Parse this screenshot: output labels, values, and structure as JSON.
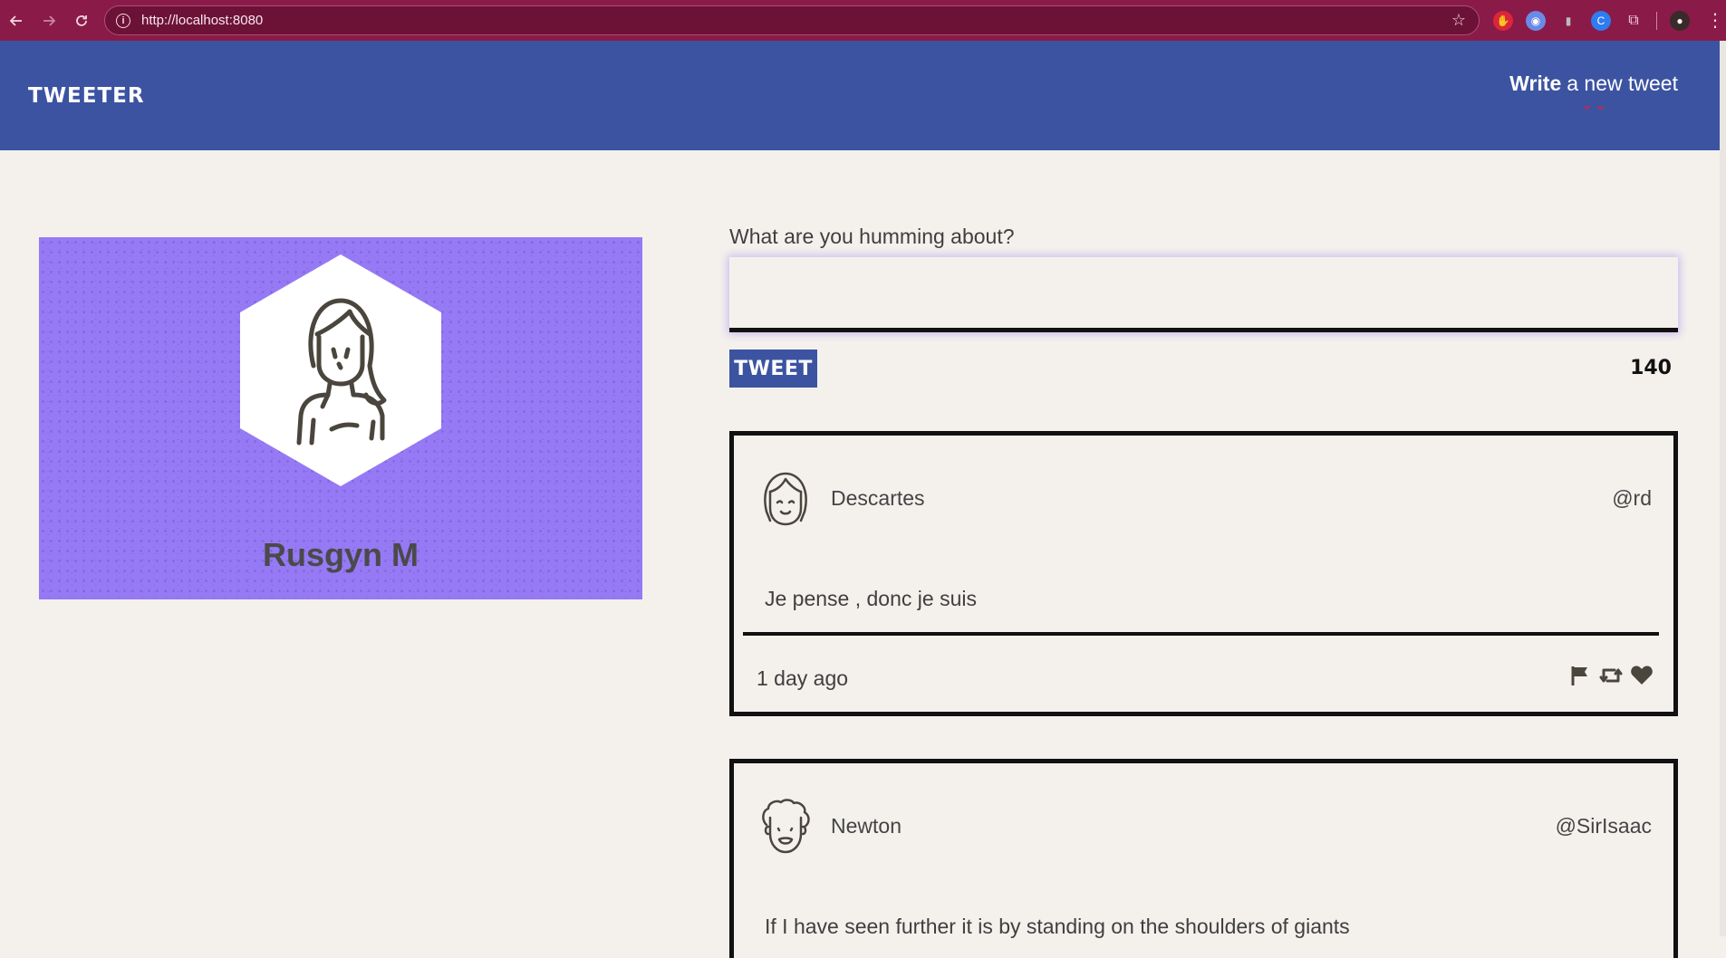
{
  "browser": {
    "url": "http://localhost:8080",
    "back_icon": "arrow-left-icon",
    "forward_icon": "arrow-right-icon",
    "reload_icon": "reload-icon"
  },
  "header": {
    "brand": "TWEETER",
    "compose_bold": "Write",
    "compose_rest": "a new tweet",
    "compose_arrow": "⌄⌄"
  },
  "profile": {
    "name": "Rusgyn M",
    "background_color": "#9679f4"
  },
  "compose": {
    "label": "What are you humming about?",
    "value": "",
    "button_label": "TWEET",
    "counter": "140"
  },
  "tweets": [
    {
      "name": "Descartes",
      "handle": "@rd",
      "body": "Je pense , donc je suis",
      "age": "1 day ago"
    },
    {
      "name": "Newton",
      "handle": "@SirIsaac",
      "body": "If I have seen further it is by standing on the shoulders of giants",
      "age": ""
    }
  ],
  "colors": {
    "header": "#3c53a1",
    "page_bg": "#f4f1ed",
    "browser_chrome": "#8a1a47"
  }
}
